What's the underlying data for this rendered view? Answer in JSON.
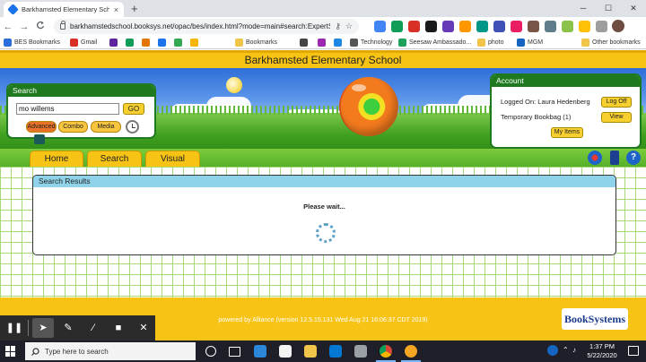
{
  "browser": {
    "tab_title": "Barkhamsted Elementary School",
    "tab_close": "×",
    "new_tab": "+",
    "min": "─",
    "max": "☐",
    "close": "✕",
    "back": "←",
    "forward": "→",
    "reload": "C",
    "url": "barkhamstedschool.booksys.net/opac/bes/index.html?mode=main#search:ExpertSe...",
    "bookmarks": [
      {
        "label": "BES Bookmarks",
        "color": "#2a6fdb"
      },
      {
        "label": "Gmail",
        "color": "#d93025"
      },
      {
        "label": "",
        "color": "#5f259f"
      },
      {
        "label": "",
        "color": "#0f9d58"
      },
      {
        "label": "",
        "color": "#e37400"
      },
      {
        "label": "",
        "color": "#1a73e8"
      },
      {
        "label": "",
        "color": "#34a853"
      },
      {
        "label": "",
        "color": "#f4b400"
      },
      {
        "label": "Bookmarks",
        "color": "#f1c54a"
      },
      {
        "label": "",
        "color": "#444"
      },
      {
        "label": "",
        "color": "#9c27b0"
      },
      {
        "label": "",
        "color": "#1e88e5"
      },
      {
        "label": "Technology",
        "color": "#555"
      },
      {
        "label": "Seesaw Ambassado...",
        "color": "#1fa35c"
      },
      {
        "label": "photo",
        "color": "#f1c54a"
      },
      {
        "label": "MGM",
        "color": "#1565c0"
      },
      {
        "label": "Other bookmarks",
        "color": "#f1c54a"
      }
    ]
  },
  "page": {
    "school_name": "Barkhamsted Elementary School",
    "search": {
      "title": "Search",
      "query": "mo willems",
      "go_label": "GO",
      "modes": [
        "Advanced",
        "Combo",
        "Media"
      ]
    },
    "account": {
      "title": "Account",
      "logged_on": "Logged On: Laura Hedenberg",
      "bookbag": "Temporary Bookbag (1)",
      "logoff_label": "Log Off",
      "view_label": "View",
      "myitems_label": "My Items"
    },
    "nav": [
      "Home",
      "Search",
      "Visual"
    ],
    "results": {
      "title": "Search Results",
      "status": "Please wait..."
    },
    "footer_text": "powered by Alliance (version 12.5.15.131 Wed Aug 21 16:06:37 CDT 2019)",
    "logo_text": "BookSystems"
  },
  "taskbar": {
    "search_placeholder": "Type here to search",
    "time": "1:37 PM",
    "date": "5/22/2020"
  }
}
